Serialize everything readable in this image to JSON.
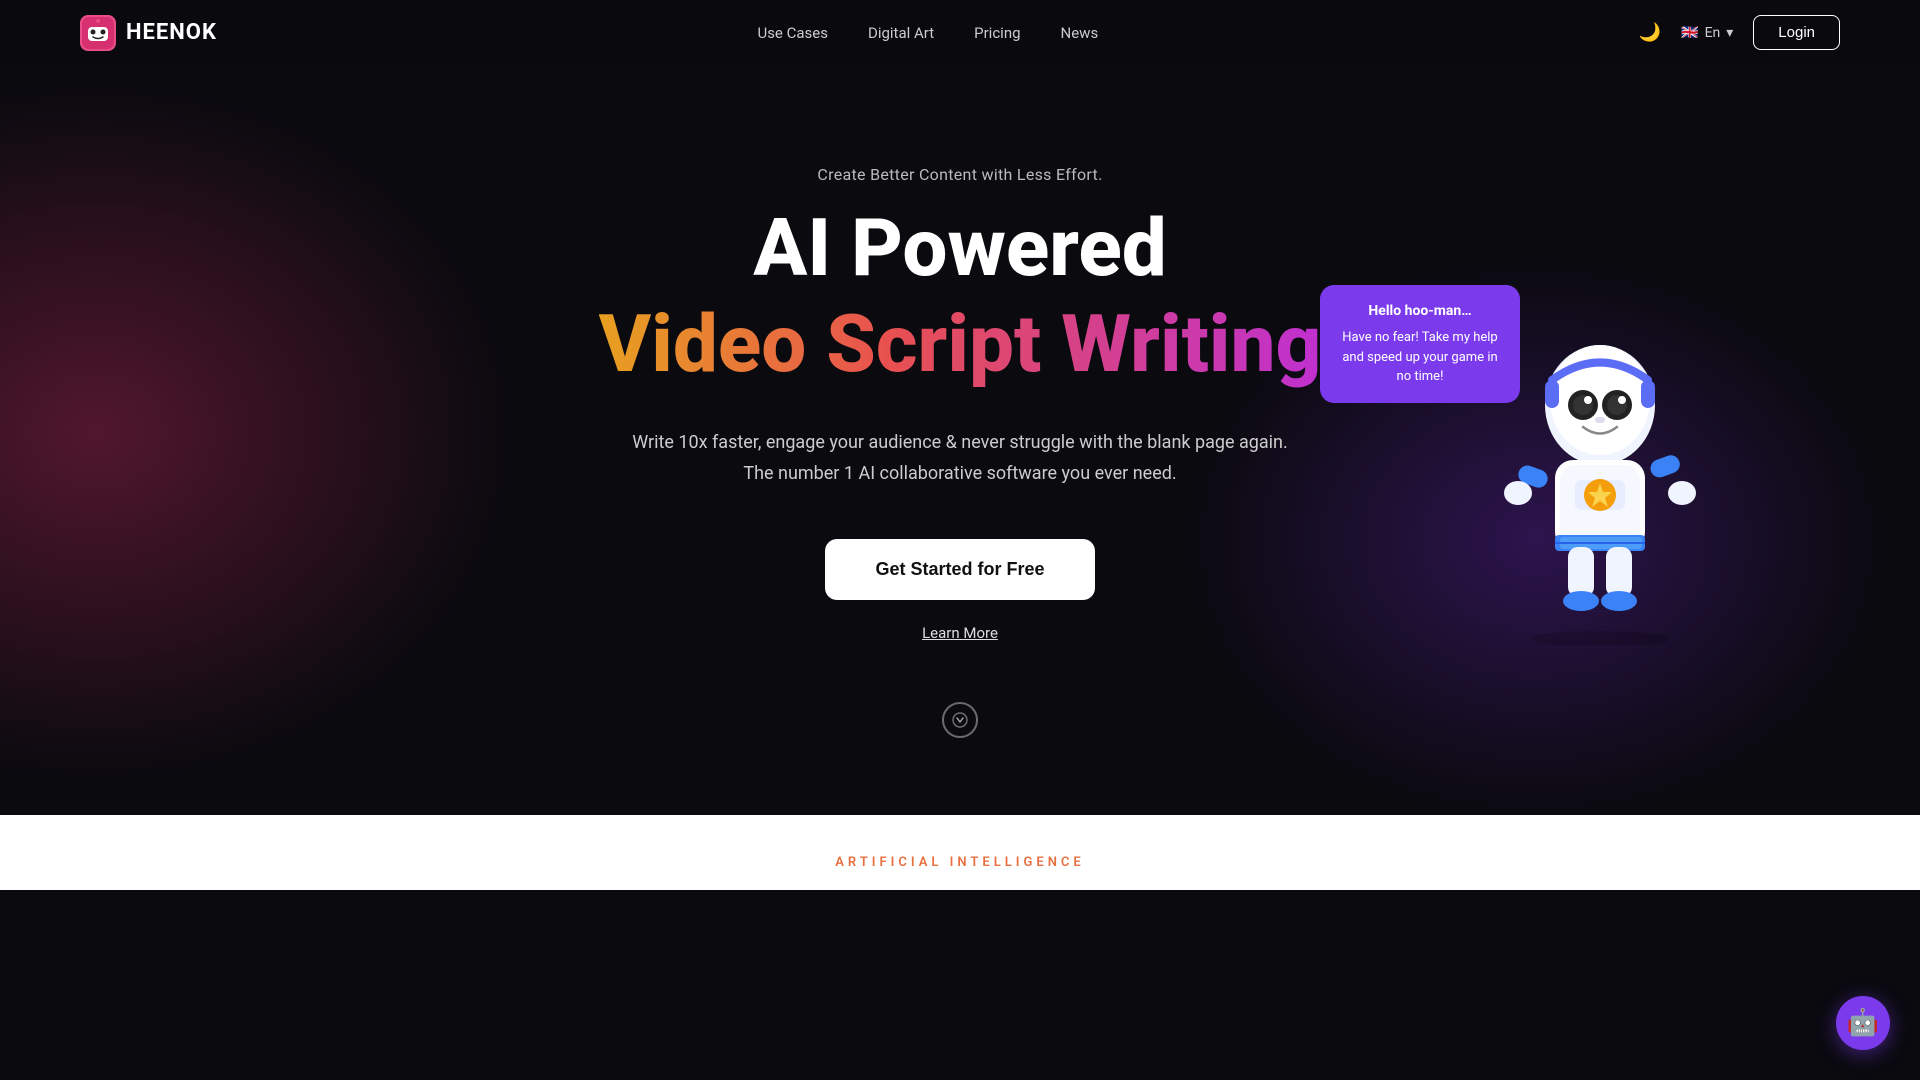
{
  "brand": {
    "name": "HEENOK",
    "logo_emoji": "🤖"
  },
  "nav": {
    "links": [
      {
        "label": "Use Cases",
        "id": "use-cases"
      },
      {
        "label": "Digital Art",
        "id": "digital-art"
      },
      {
        "label": "Pricing",
        "id": "pricing"
      },
      {
        "label": "News",
        "id": "news"
      }
    ],
    "theme_icon": "🌙",
    "lang_flag": "🇬🇧",
    "lang_label": "En",
    "lang_chevron": "▾",
    "login_label": "Login"
  },
  "hero": {
    "subtitle": "Create Better Content with Less Effort.",
    "title_line1": "AI Powered",
    "title_line2": "Video Script Writing",
    "description_line1": "Write 10x faster, engage your audience & never struggle with the blank page again.",
    "description_line2": "The number 1 AI collaborative software you ever need.",
    "cta_label": "Get Started for Free",
    "learn_more_label": "Learn More"
  },
  "robot_bubble": {
    "title": "Hello hoo-man…",
    "body": "Have no fear! Take my help and speed up your game in no time!"
  },
  "bottom": {
    "ai_label": "ARTIFICIAL INTELLIGENCE"
  },
  "chatbot": {
    "icon": "🤖"
  },
  "scroll_down_label": "↓"
}
